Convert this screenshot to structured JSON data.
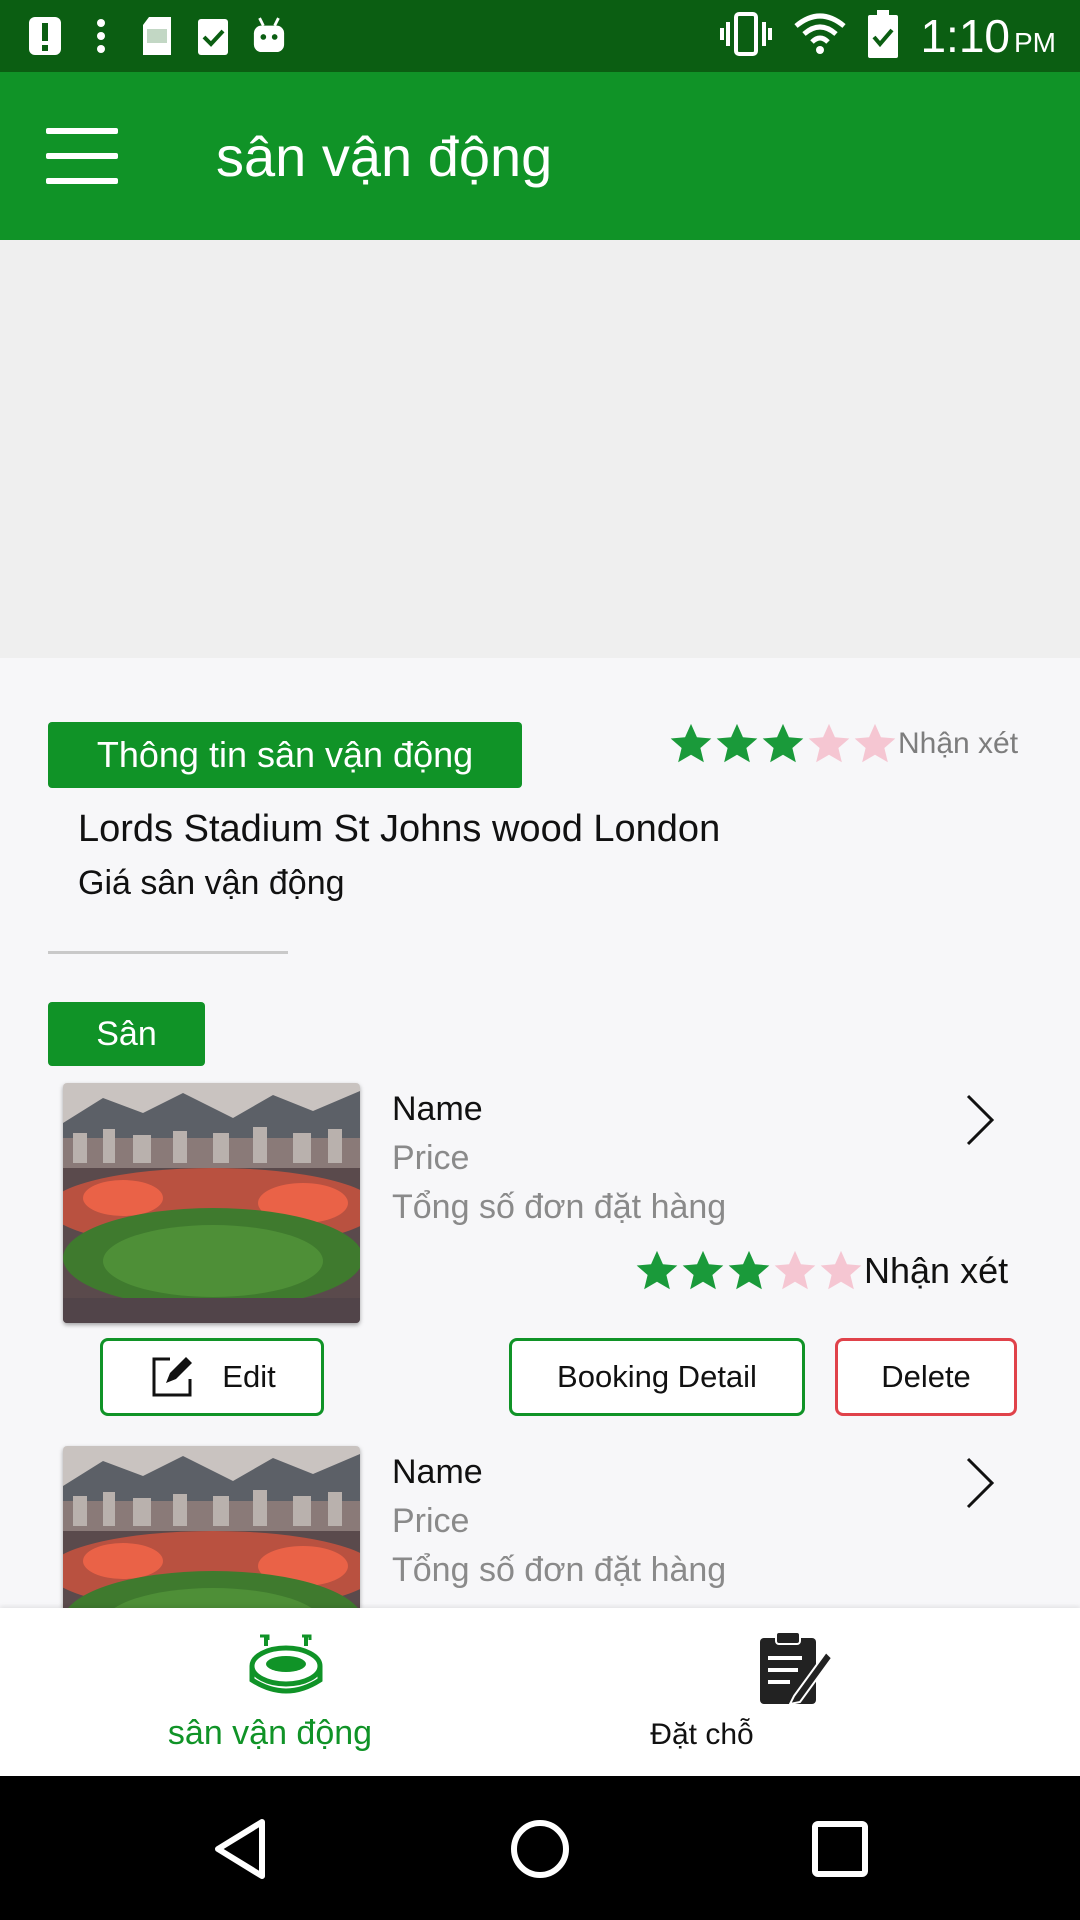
{
  "status_bar": {
    "time": "1:10",
    "ampm": "PM",
    "left_icons": [
      "alert-icon",
      "more-vert-icon",
      "sd-card-icon",
      "clipboard-check-icon",
      "android-icon"
    ],
    "right_icons": [
      "vibrate-icon",
      "wifi-icon",
      "battery-icon"
    ]
  },
  "app_bar": {
    "title": "sân vận động"
  },
  "info": {
    "tag_label": "Thông tin sân vận động",
    "rating": {
      "filled": 3,
      "total": 5,
      "label": "Nhận xét"
    },
    "stadium_name": "Lords Stadium St Johns wood London",
    "stadium_price": "Giá sân vận động"
  },
  "section": {
    "tag_label": "Sân"
  },
  "fields": [
    {
      "name": "Name",
      "price": "Price",
      "orders": "Tổng số đơn đặt hàng",
      "rating": {
        "filled": 3,
        "total": 5,
        "label": "Nhận xét"
      },
      "edit_label": "Edit",
      "booking_label": "Booking Detail",
      "delete_label": "Delete"
    },
    {
      "name": "Name",
      "price": "Price",
      "orders": "Tổng số đơn đặt hàng"
    }
  ],
  "bottom_nav": {
    "items": [
      {
        "label": "sân vận động",
        "icon": "stadium-icon",
        "active": true
      },
      {
        "label": "Đặt chỗ",
        "icon": "booking-clipboard-icon",
        "active": false
      }
    ]
  },
  "system_nav": [
    "back-icon",
    "home-icon",
    "recents-icon"
  ],
  "colors": {
    "primary": "#109327",
    "status_bar": "#0b5e12",
    "star_filled": "#1a9a3a",
    "star_empty": "#f5c6d2",
    "delete": "#e0424a"
  }
}
